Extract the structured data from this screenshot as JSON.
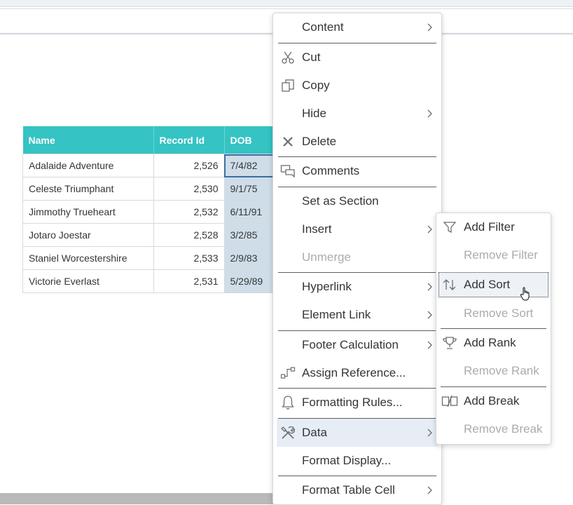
{
  "table": {
    "headers": [
      "Name",
      "Record Id",
      "DOB"
    ],
    "rows": [
      {
        "name": "Adalaide Adventure",
        "record_id": "2,526",
        "dob": "7/4/82"
      },
      {
        "name": "Celeste Triumphant",
        "record_id": "2,530",
        "dob": "9/1/75"
      },
      {
        "name": "Jimmothy Trueheart",
        "record_id": "2,532",
        "dob": "6/11/91"
      },
      {
        "name": "Jotaro Joestar",
        "record_id": "2,528",
        "dob": "3/2/85"
      },
      {
        "name": "Staniel Worcestershire",
        "record_id": "2,533",
        "dob": "2/9/83"
      },
      {
        "name": "Victorie Everlast",
        "record_id": "2,531",
        "dob": "5/29/89"
      }
    ]
  },
  "context_menu": {
    "items": [
      {
        "label": "Content",
        "icon": "",
        "submenu": true
      },
      {
        "label": "Cut",
        "icon": "scissors-icon"
      },
      {
        "label": "Copy",
        "icon": "copy-icon"
      },
      {
        "label": "Hide",
        "icon": "",
        "submenu": true
      },
      {
        "label": "Delete",
        "icon": "close-icon"
      },
      {
        "label": "Comments",
        "icon": "comments-icon"
      },
      {
        "label": "Set as Section",
        "icon": ""
      },
      {
        "label": "Insert",
        "icon": "",
        "submenu": true
      },
      {
        "label": "Unmerge",
        "icon": "",
        "disabled": true
      },
      {
        "label": "Hyperlink",
        "icon": "",
        "submenu": true
      },
      {
        "label": "Element Link",
        "icon": "",
        "submenu": true
      },
      {
        "label": "Footer Calculation",
        "icon": "",
        "submenu": true
      },
      {
        "label": "Assign Reference...",
        "icon": "reference-icon"
      },
      {
        "label": "Formatting Rules...",
        "icon": "bell-icon"
      },
      {
        "label": "Data",
        "icon": "tools-icon",
        "submenu": true,
        "active": true
      },
      {
        "label": "Format Display...",
        "icon": ""
      },
      {
        "label": "Format Table Cell",
        "icon": "",
        "submenu": true
      }
    ]
  },
  "data_submenu": {
    "items": [
      {
        "label": "Add Filter",
        "icon": "filter-icon"
      },
      {
        "label": "Remove Filter",
        "icon": "",
        "disabled": true
      },
      {
        "label": "Add Sort",
        "icon": "sort-icon",
        "focused": true
      },
      {
        "label": "Remove Sort",
        "icon": "",
        "disabled": true
      },
      {
        "label": "Add Rank",
        "icon": "trophy-icon"
      },
      {
        "label": "Remove Rank",
        "icon": "",
        "disabled": true
      },
      {
        "label": "Add Break",
        "icon": "break-icon"
      },
      {
        "label": "Remove Break",
        "icon": "",
        "disabled": true
      }
    ]
  },
  "colors": {
    "header_teal": "#35c3c3",
    "selected_column": "#cfdde8",
    "menu_hover": "#e6edf5",
    "disabled_text": "#a9acaf"
  }
}
